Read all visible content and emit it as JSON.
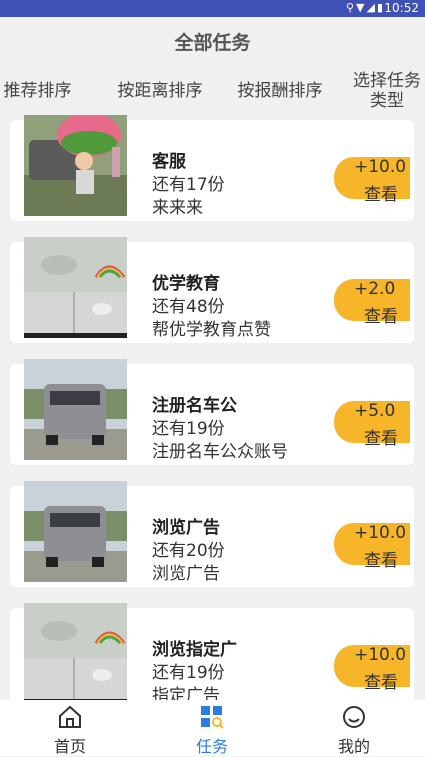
{
  "status": {
    "time": "10:52",
    "icons": "⚲▼◢▮"
  },
  "header": {
    "title": "全部任务"
  },
  "sort": {
    "recommend": "推荐排序",
    "distance": "按距离排序",
    "reward": "按报酬排序",
    "choose": "选择任务类型"
  },
  "tasks": [
    {
      "title": "客服",
      "remain": "还有17份",
      "desc": "来来来",
      "amount": "+10.0",
      "view": "查看"
    },
    {
      "title": "优学教育",
      "remain": "还有48份",
      "desc": "帮优学教育点赞",
      "amount": "+2.0",
      "view": "查看"
    },
    {
      "title": "注册名车公",
      "remain": "还有19份",
      "desc": "注册名车公众账号",
      "amount": "+5.0",
      "view": "查看"
    },
    {
      "title": "浏览广告",
      "remain": "还有20份",
      "desc": "浏览广告",
      "amount": "+10.0",
      "view": "查看"
    },
    {
      "title": "浏览指定广",
      "remain": "还有19份",
      "desc": "指定广告",
      "amount": "+10.0",
      "view": "查看"
    }
  ],
  "nav": {
    "home": "首页",
    "task": "任务",
    "me": "我的"
  },
  "colors": {
    "statusbar": "#3f51b5",
    "accent": "#f7b52a",
    "active": "#2d7ce0"
  }
}
